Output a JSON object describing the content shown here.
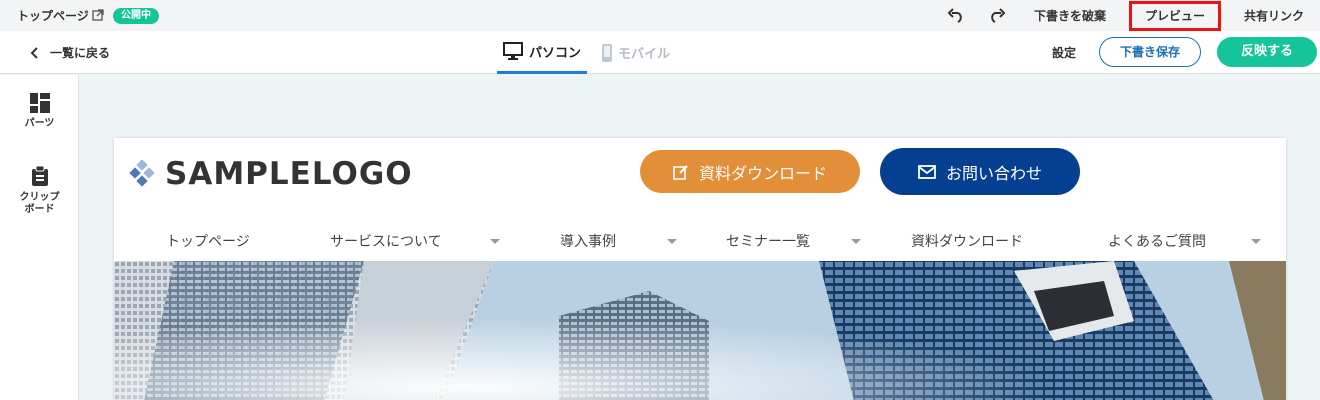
{
  "topbar": {
    "page_name": "トップページ",
    "status": "公開中",
    "discard_label": "下書きを破棄",
    "preview_label": "プレビュー",
    "share_label": "共有リンク"
  },
  "toolbar": {
    "back_label": "一覧に戻る",
    "tab_pc": "パソコン",
    "tab_mobile": "モバイル",
    "settings_label": "設定",
    "save_draft_label": "下書き保存",
    "publish_label": "反映する"
  },
  "sidebar": {
    "parts_label": "パーツ",
    "clipboard_line1": "クリップ",
    "clipboard_line2": "ボード"
  },
  "site": {
    "logo_text": "SAMPLELOGO",
    "download_label": "資料ダウンロード",
    "contact_label": "お問い合わせ",
    "nav": [
      "トップページ",
      "サービスについて",
      "導入事例",
      "セミナー一覧",
      "資料ダウンロード",
      "よくあるご質問"
    ]
  },
  "colors": {
    "accent_green": "#14c59a",
    "accent_blue": "#1e6fb8",
    "highlight_red": "#ee1111",
    "download_orange": "#e38f3a",
    "contact_navy": "#053f92"
  }
}
